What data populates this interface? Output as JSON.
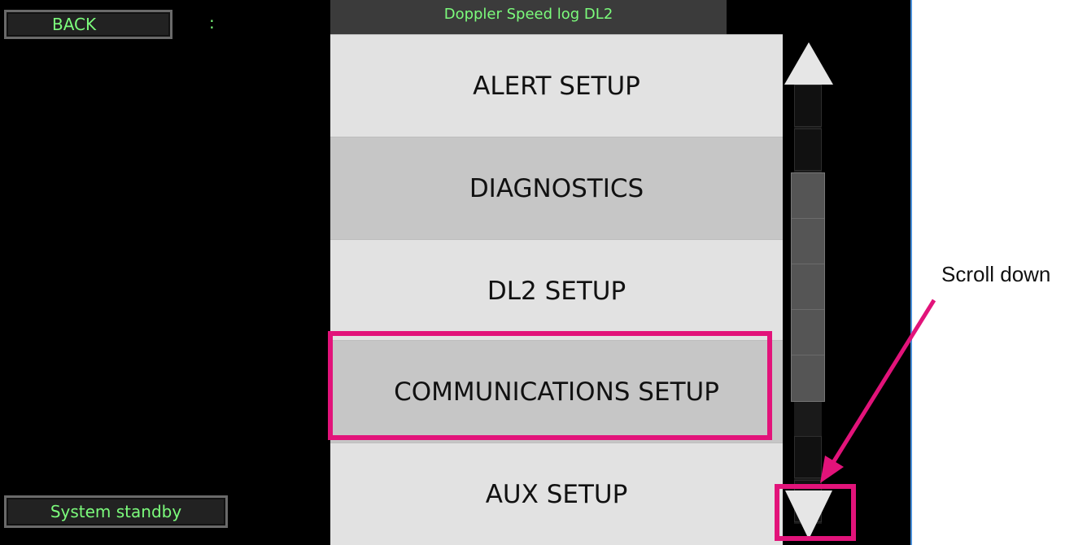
{
  "header": {
    "back_label": "BACK",
    "separator": ":",
    "title": "Doppler Speed log DL2"
  },
  "status": {
    "text": "System standby"
  },
  "menu": {
    "items": [
      {
        "label": "ALERT SETUP"
      },
      {
        "label": "DIAGNOSTICS"
      },
      {
        "label": "DL2 SETUP"
      },
      {
        "label": "COMMUNICATIONS SETUP"
      },
      {
        "label": "AUX SETUP"
      }
    ]
  },
  "scrollbar": {
    "up_icon": "triangle-up-icon",
    "down_icon": "triangle-down-icon"
  },
  "annotation": {
    "callout_text": "Scroll down",
    "highlight_color": "#e2137a"
  },
  "colors": {
    "screen_bg": "#000000",
    "text_green": "#7CFC7C",
    "menu_light": "#e2e2e2",
    "menu_dark": "#c6c6c6"
  }
}
